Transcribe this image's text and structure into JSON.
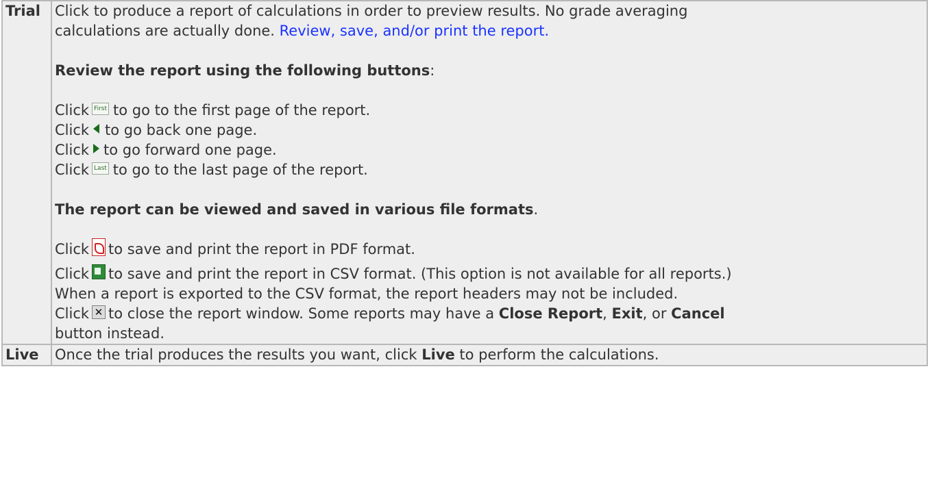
{
  "rows": [
    {
      "label": "Trial",
      "intro": "Click to produce a report of calculations in order to preview results. No grade averaging",
      "intro2": "calculations are actually done. ",
      "link": "Review, save, and/or print the report.",
      "review_heading": "Review the report using the following buttons",
      "review_heading_suffix": ":",
      "click": "Click",
      "nav": [
        {
          "button_label": "First",
          "text": "to go to the first page of the report."
        },
        {
          "text": "to go back one page."
        },
        {
          "text": "to go forward one page."
        },
        {
          "button_label": "Last",
          "text": "to go to the last page of the report."
        }
      ],
      "formats_heading": "The report can be viewed and saved in various file formats",
      "formats_heading_suffix": ".",
      "pdf_text": "to save and print the report in PDF format.",
      "csv_text": "to save and print the report in CSV format. (This option is not available for all reports.)",
      "csv_note": "When a report is exported to the CSV format, the report headers may not be included.",
      "close_text": "to close the report window. Some reports may have a ",
      "close_report": "Close Report",
      "comma1": ", ",
      "exit": "Exit",
      "or": ", or ",
      "cancel": "Cancel",
      "close_end": "button instead."
    },
    {
      "label": "Live",
      "text_before": "Once the trial produces the results you want, click ",
      "live_bold": "Live",
      "text_after": " to perform the calculations."
    }
  ],
  "colors": {
    "cell_bg": "#eeeeee",
    "border": "#b8b8b8",
    "link": "#1a33ff",
    "text": "#333333"
  },
  "icons": [
    "first-page-icon",
    "previous-page-icon",
    "next-page-icon",
    "last-page-icon",
    "pdf-icon",
    "csv-icon",
    "close-icon"
  ]
}
